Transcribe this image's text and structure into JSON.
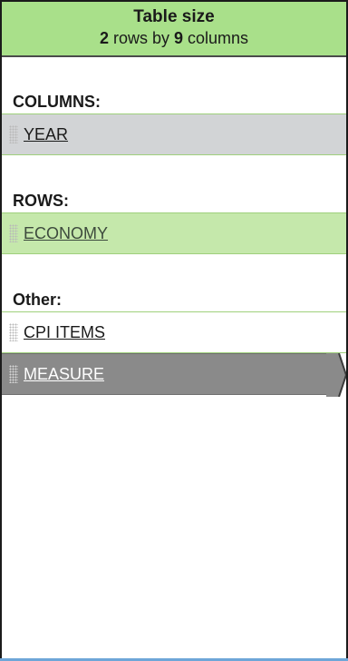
{
  "header": {
    "title": "Table size",
    "rows_count": "2",
    "rows_text": "rows by",
    "cols_count": "9",
    "cols_text": "columns"
  },
  "sections": {
    "columns": {
      "label": "COLUMNS:",
      "items": [
        "YEAR"
      ]
    },
    "rows": {
      "label": "ROWS:",
      "items": [
        "ECONOMY"
      ]
    },
    "other": {
      "label": "Other:",
      "items": [
        "CPI ITEMS",
        "MEASURE"
      ]
    }
  },
  "colors": {
    "header_bg": "#a9e08a",
    "columns_row_bg": "#d2d4d6",
    "rows_row_bg": "#c5e8ab",
    "selected_row_bg": "#8a8a8a"
  },
  "selected_item": "MEASURE"
}
